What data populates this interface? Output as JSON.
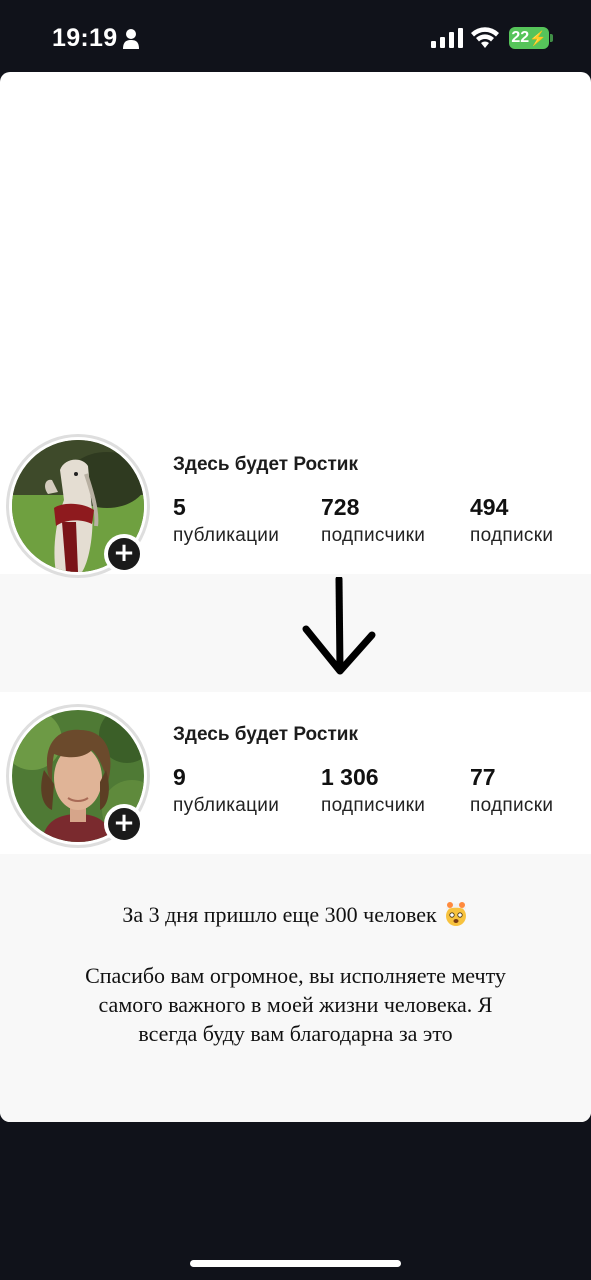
{
  "status_bar": {
    "time": "19:19",
    "battery": "22",
    "icons": [
      "person-icon",
      "signal-icon",
      "wifi-icon",
      "battery-icon"
    ]
  },
  "profiles": [
    {
      "username": "Здесь будет Ростик",
      "stats": [
        {
          "value": "5",
          "label": "публикации"
        },
        {
          "value": "728",
          "label": "подписчики"
        },
        {
          "value": "494",
          "label": "подписки"
        }
      ]
    },
    {
      "username": "Здесь будет Ростик",
      "stats": [
        {
          "value": "9",
          "label": "публикации"
        },
        {
          "value": "1 306",
          "label": "подписчики"
        },
        {
          "value": "77",
          "label": "подписки"
        }
      ]
    }
  ],
  "caption": {
    "line1": "За 3 дня пришло еще 300 человек",
    "line1_emoji": "exploding-head-emoji",
    "line2": "Спасибо вам огромное, вы исполняете мечту",
    "line3": "самого важного в моей жизни человека. Я",
    "line4": "всегда буду вам благодарна за это"
  },
  "colors": {
    "background": "#10121a",
    "card": "#ffffff",
    "band": "#f8f8f8",
    "battery": "#56c45a"
  }
}
